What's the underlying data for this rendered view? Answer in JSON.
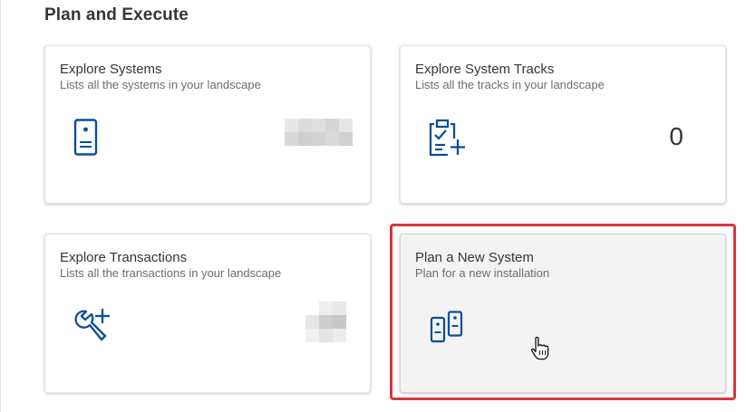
{
  "section": {
    "title": "Plan and Execute"
  },
  "tiles": [
    {
      "title": "Explore Systems",
      "subtitle": "Lists all the systems in your landscape",
      "icon": "system-device-icon",
      "count_obscured": true
    },
    {
      "title": "Explore System Tracks",
      "subtitle": "Lists all the tracks in your landscape",
      "icon": "clipboard-check-add-icon",
      "count": "0"
    },
    {
      "title": "Explore Transactions",
      "subtitle": "Lists all the transactions in your landscape",
      "icon": "wrench-add-icon",
      "count_obscured": true
    },
    {
      "title": "Plan a New System",
      "subtitle": "Plan for a new installation",
      "icon": "dual-system-icon",
      "highlighted": true,
      "hovered": true
    }
  ],
  "colors": {
    "icon": "#0a4e9b",
    "highlight": "#d9363e",
    "title_text": "#32363a",
    "subtitle_text": "#6a6d70",
    "hover_background": "#f3f3f3"
  },
  "cursor": "hand-pointer-icon"
}
